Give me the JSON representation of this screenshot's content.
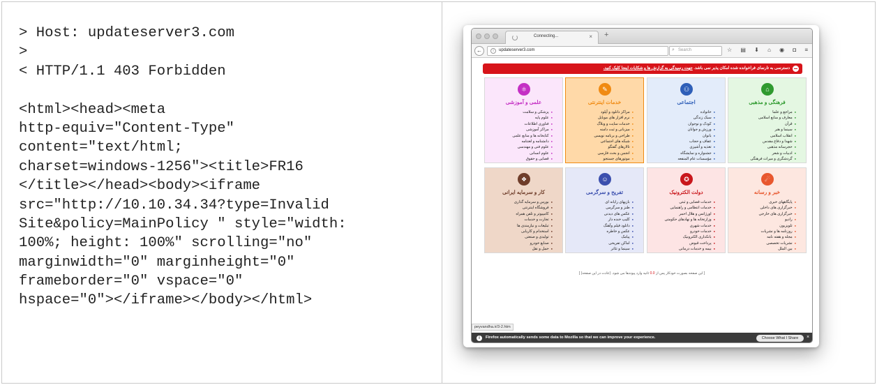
{
  "code_lines": [
    "> Host: updateserver3.com",
    ">",
    "< HTTP/1.1 403 Forbidden",
    "",
    "<html><head><meta",
    "http-equiv=\"Content-Type\"",
    "content=\"text/html;",
    "charset=windows-1256\"><title>FR16",
    "</title></head><body><iframe",
    "src=\"http://10.10.34.34?type=Invalid",
    "Site&policy=MainPolicy \" style=\"width:",
    "100%; height: 100%\" scrolling=\"no\"",
    "marginwidth=\"0\" marginheight=\"0\"",
    "frameborder=\"0\" vspace=\"0\"",
    "hspace=\"0\"></iframe></body></html>"
  ],
  "browser": {
    "tab_title": "Connecting...",
    "tab_close": "×",
    "new_tab": "+",
    "back_icon": "←",
    "url": "updateserver3.com",
    "stop_icon": "✕",
    "search_placeholder": "Search",
    "toolbar_icons": [
      "star-icon",
      "clipboard-icon",
      "download-icon",
      "home-icon",
      "pocket-icon",
      "shield-icon",
      "menu-icon"
    ],
    "toolbar_glyphs": "☆ ▤ ⬇ ⌂ ◉ ◘ ≡",
    "status_url": "peyvandha.ir/3-2.htm",
    "notification": "Firefox automatically sends some data to Mozilla so that we can improve your experience.",
    "notification_button": "Choose What I Share",
    "notification_close": "×"
  },
  "blocked_page": {
    "banner_text": "دسترسی به تارنمای فراخوانده شده امکان پذیر نمی باشد.",
    "banner_link": "جهت رسیدگی به گزارش ها و شکایات اینجا کلیک کنید.",
    "categories": [
      {
        "title": "فرهنگی و مذهبی",
        "icon": "mosque-icon",
        "glyph": "⌂",
        "color": "#2f9a2f",
        "bg": "#e4f7e2",
        "items": [
          "مراجع و علما",
          "معارف و منابع اسلامی",
          "قرآن",
          "سینما و هنر",
          "انقلاب اسلامی",
          "شهدا و دفاع مقدس",
          "حجرسانه مذهبی",
          "ادبیات و شعر",
          "گردشگری و میراث فرهنگی"
        ]
      },
      {
        "title": "اجتماعی",
        "icon": "people-icon",
        "glyph": "⚇",
        "color": "#2f5fb8",
        "bg": "#e3ecfa",
        "items": [
          "خانواده",
          "سبک زندگی",
          "کودک و نوجوان",
          "ورزش و جوانان",
          "بانوان",
          "عفاف و حجاب",
          "تغذیه و آشپزی",
          "جشنواره و نمایشگاه",
          "مؤسسات عام المنفعه"
        ]
      },
      {
        "title": "خدمات اینترنتی",
        "icon": "wrench-icon",
        "glyph": "✎",
        "color": "#f08a12",
        "bg": "#ffd9a8",
        "items": [
          "مراکز دانلود و آپلود",
          "نرم افزار های موبایل",
          "خدمات سایت و وبلاگ",
          "میزبانی و ثبت دامنه",
          "طراحی و برنامه نویسی",
          "شبکه های اجتماعی",
          "تالارهای گفتگو",
          "انجمن و بحث فارسی",
          "موتورهای جستجو"
        ]
      },
      {
        "title": "علمی و آموزشی",
        "icon": "atom-icon",
        "glyph": "⚛",
        "color": "#c42fc4",
        "bg": "#fbe6fb",
        "items": [
          "پزشکی و سلامت",
          "علوم پایه",
          "فناوری اطلاعات",
          "مراکز آموزشی",
          "کتابخانه ها و منابع علمی",
          "دانشنامه و لغتنامه",
          "علوم فنی و مهندسی",
          "علوم انسانی",
          "قضایی و حقوق"
        ]
      },
      {
        "title": "خبر و رسانه",
        "icon": "satellite-icon",
        "glyph": "☄",
        "color": "#e8572e",
        "bg": "#fde7e0",
        "items": [
          "پایگاههای خبری",
          "خبرگزاری های داخلی",
          "خبرگزاری های خارجی",
          "رادیو",
          "تلویزیون",
          "روزنامه ها و نشریات",
          "مجله و هفته نامه",
          "نشریات تخصصی",
          "بین الملل"
        ]
      },
      {
        "title": "دولت الکترونیک",
        "icon": "emblem-icon",
        "glyph": "✪",
        "color": "#c9171c",
        "bg": "#fde4e4",
        "items": [
          "خدمات قضایی و ثبتی",
          "خدمات انتظامی و راهنمایی",
          "اورژانس و هلال احمر",
          "وزارتخانه ها و نهادهای حکومتی",
          "خدمات شهری",
          "خدمات خودرو",
          "بانکداری الکترونیک",
          "پرداخت قبوض",
          "بیمه و خدمات درمانی"
        ]
      },
      {
        "title": "تفریح و سرگرمی",
        "icon": "people-play-icon",
        "glyph": "☺",
        "color": "#3b4fae",
        "bg": "#e5e8f8",
        "items": [
          "بازیهای رایانه ای",
          "طنز و سرگرمی",
          "عکس های دیدنی",
          "کلیپ خنده دار",
          "دانلود فیلم وآهنگ",
          "عکس و خاطره",
          "پیامک",
          "اماکن تفریحی",
          "سینما و تئاتر"
        ]
      },
      {
        "title": "کار و سرمایه ایرانی",
        "icon": "business-icon",
        "glyph": "❖",
        "color": "#6f3d2a",
        "bg": "#efd7c8",
        "items": [
          "بورس و سرمایه گذاری",
          "فروشگاه اینترنتی",
          "کامپیوتر و تلفن همراه",
          "تجارت و خدمات",
          "تبلیغات و نیازمندی ها",
          "استخدام و کاریابی",
          "تولیدی و صنعتی",
          "صنایع خودرو",
          "حمل و نقل"
        ]
      }
    ],
    "footnote_pre": "[ این صفحه بصورت خودکار پس از",
    "footnote_num": "0.0",
    "footnote_post": "ثانیه وارد پیوندها می شود. (عادت در این صفحه) ]"
  }
}
